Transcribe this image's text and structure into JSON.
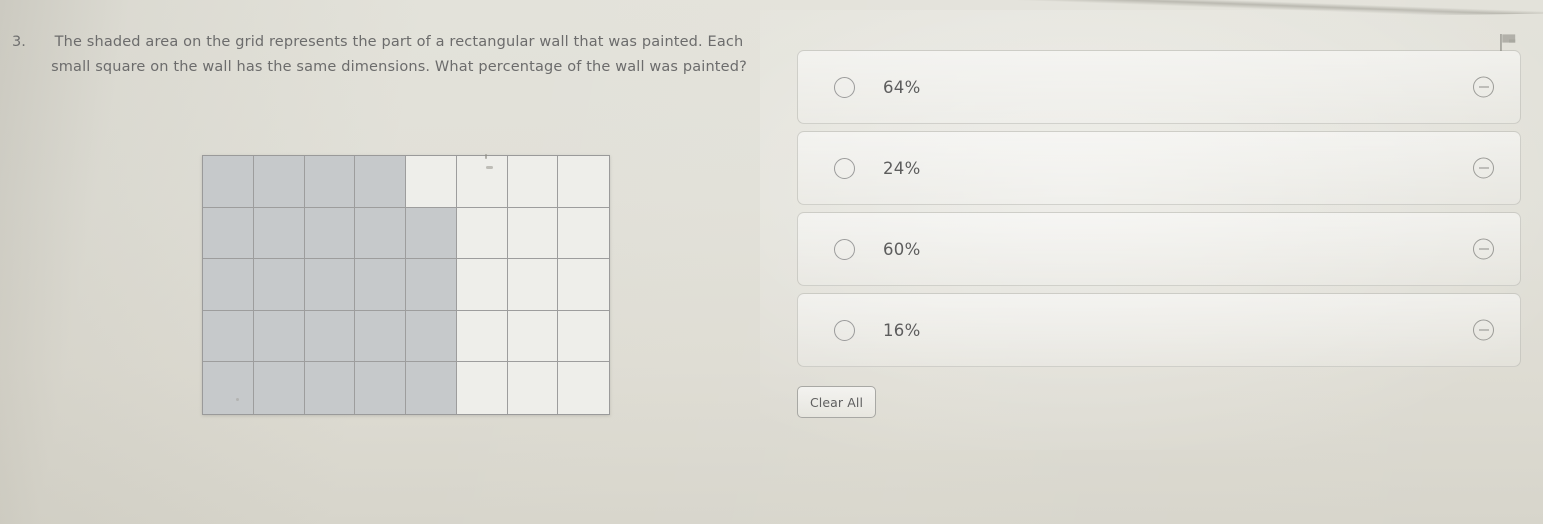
{
  "question": {
    "number": "3.",
    "text": "The shaded area on the grid represents the part of a rectangular wall that was painted. Each small square on the wall has the same dimensions. What percentage of the wall was painted?"
  },
  "figure": {
    "name": "shaded-grid",
    "columns": 8,
    "rows": 5,
    "total_cells": 40,
    "shaded_cells": 24,
    "shaded_per_row": [
      4,
      5,
      5,
      5,
      5
    ],
    "shaded_color": "#c6c9cb",
    "unshaded_color": "#eeeeea",
    "line_color": "#9d9d9d"
  },
  "options": [
    {
      "label": "64%",
      "selected": false,
      "radio_name": "radio-button-64",
      "eliminate_name": "eliminate-icon-64"
    },
    {
      "label": "24%",
      "selected": false,
      "radio_name": "radio-button-24",
      "eliminate_name": "eliminate-icon-24"
    },
    {
      "label": "60%",
      "selected": false,
      "radio_name": "radio-button-60",
      "eliminate_name": "eliminate-icon-60"
    },
    {
      "label": "16%",
      "selected": false,
      "radio_name": "radio-button-16",
      "eliminate_name": "eliminate-icon-16"
    }
  ],
  "toolbar": {
    "clear_all_label": "Clear All"
  },
  "icons": {
    "flag": "flag-icon",
    "eliminate": "minus-circle-icon",
    "radio": "radio-circle-icon"
  },
  "colors": {
    "page_background": "#e1e0d8",
    "text": "#6c6c6c",
    "option_text": "#5d5d5d",
    "border": "#a8a8a4"
  }
}
